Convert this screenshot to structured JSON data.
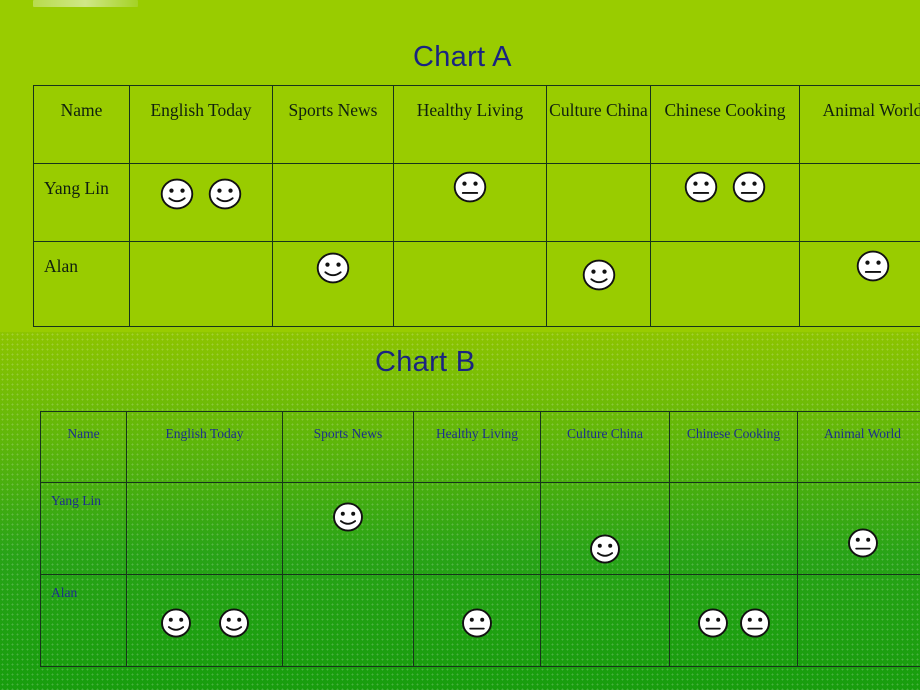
{
  "slide": {
    "background_top_color": "#99cc00",
    "background_bottom_color": "#1aa014",
    "title_color": "#1a2480"
  },
  "charts": [
    {
      "id": "chart-a",
      "title": "Chart A",
      "columns": [
        "Name",
        "English Today",
        "Sports News",
        "Healthy Living",
        "Culture China",
        "Chinese Cooking",
        "Animal World"
      ],
      "rows": [
        {
          "name": "Yang Lin",
          "cells": [
            {
              "column": "English Today",
              "faces": [
                "smile",
                "smile"
              ]
            },
            {
              "column": "Sports News",
              "faces": []
            },
            {
              "column": "Healthy Living",
              "faces": [
                "neutral"
              ]
            },
            {
              "column": "Culture China",
              "faces": []
            },
            {
              "column": "Chinese Cooking",
              "faces": [
                "neutral",
                "neutral"
              ]
            },
            {
              "column": "Animal World",
              "faces": []
            }
          ]
        },
        {
          "name": "Alan",
          "cells": [
            {
              "column": "English Today",
              "faces": []
            },
            {
              "column": "Sports News",
              "faces": [
                "smile"
              ]
            },
            {
              "column": "Healthy Living",
              "faces": []
            },
            {
              "column": "Culture China",
              "faces": [
                "smile"
              ]
            },
            {
              "column": "Chinese Cooking",
              "faces": []
            },
            {
              "column": "Animal World",
              "faces": [
                "neutral"
              ]
            }
          ]
        }
      ]
    },
    {
      "id": "chart-b",
      "title": "Chart B",
      "columns": [
        "Name",
        "English Today",
        "Sports News",
        "Healthy Living",
        "Culture China",
        "Chinese Cooking",
        "Animal World"
      ],
      "rows": [
        {
          "name": "Yang Lin",
          "cells": [
            {
              "column": "English Today",
              "faces": []
            },
            {
              "column": "Sports News",
              "faces": [
                "smile"
              ]
            },
            {
              "column": "Healthy Living",
              "faces": []
            },
            {
              "column": "Culture China",
              "faces": [
                "smile"
              ]
            },
            {
              "column": "Chinese Cooking",
              "faces": []
            },
            {
              "column": "Animal World",
              "faces": [
                "neutral"
              ]
            }
          ]
        },
        {
          "name": "Alan",
          "cells": [
            {
              "column": "English Today",
              "faces": [
                "smile",
                "smile"
              ]
            },
            {
              "column": "Sports News",
              "faces": []
            },
            {
              "column": "Healthy Living",
              "faces": [
                "neutral"
              ]
            },
            {
              "column": "Culture China",
              "faces": []
            },
            {
              "column": "Chinese Cooking",
              "faces": [
                "neutral",
                "neutral"
              ]
            },
            {
              "column": "Animal World",
              "faces": []
            }
          ]
        }
      ]
    }
  ]
}
